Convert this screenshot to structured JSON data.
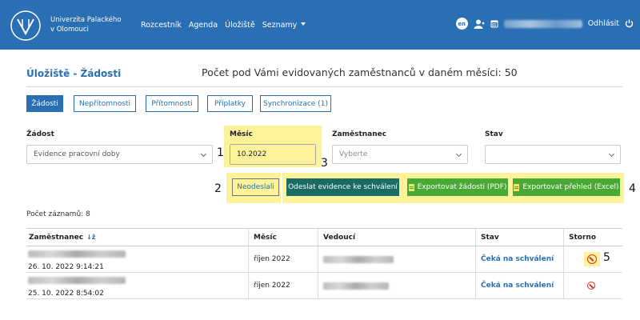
{
  "header": {
    "uni_line1": "Univerzita Palackého",
    "uni_line2": "v Olomouci",
    "nav": [
      "Rozcestník",
      "Agenda",
      "Úložiště",
      "Seznamy"
    ],
    "lang": "en",
    "logout": "Odhlásit"
  },
  "page": {
    "title": "Úložiště - Žádosti",
    "employee_count": "Počet pod Vámi evidovaných zaměstnanců v daném měsíci: 50"
  },
  "tabs": [
    "Žádosti",
    "Nepřítomnosti",
    "Přítomnosti",
    "Příplatky",
    "Synchronizace (1)"
  ],
  "filters": {
    "request_label": "Žádost",
    "request_value": "Evidence pracovní doby",
    "month_label": "Měsíc",
    "month_value": "10.2022",
    "employee_label": "Zaměstnanec",
    "employee_placeholder": "Vyberte",
    "state_label": "Stav",
    "state_value": ""
  },
  "annotations": [
    "1",
    "2",
    "3",
    "4",
    "5"
  ],
  "actions": {
    "unsent": "Neodeslali",
    "send": "Odeslat evidence ke schválení",
    "export_pdf": "Exportovat žádosti (PDF)",
    "export_excel": "Exportovat přehled (Excel)"
  },
  "record_count": "Počet záznamů: 8",
  "table": {
    "headers": [
      "Zaměstnanec",
      "Měsíc",
      "Vedoucí",
      "Stav",
      "Storno"
    ],
    "rows": [
      {
        "date": "26. 10. 2022 9:14:21",
        "month": "říjen 2022",
        "status": "Čeká na schválení"
      },
      {
        "date": "25. 10. 2022 8:54:02",
        "month": "říjen 2022",
        "status": "Čeká na schválení"
      }
    ]
  },
  "colors": {
    "brand": "#2a6fb3",
    "highlight": "#fcf29a",
    "teal": "#1a6b62",
    "green": "#49a935",
    "danger": "#d33333"
  },
  "icons": {
    "logo": "upol-logo-icon",
    "user": "user-icon",
    "calendar": "calendar-icon",
    "power": "power-icon",
    "sort": "sort-icon",
    "storno": "cancel-icon"
  }
}
